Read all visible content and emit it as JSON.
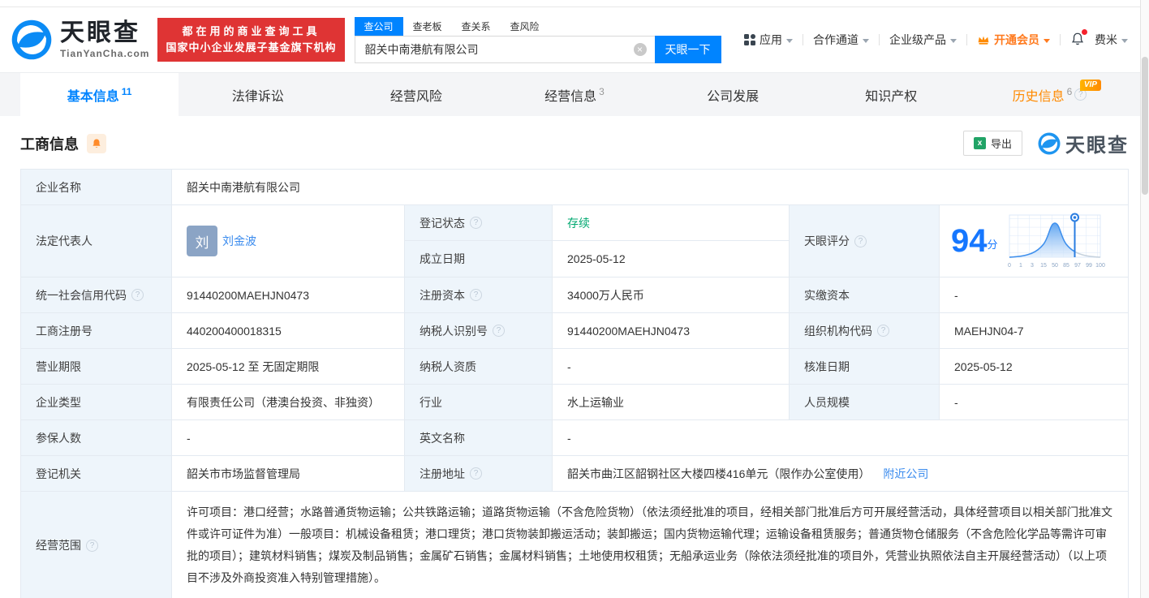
{
  "brand": {
    "name": "天眼查",
    "domain": "TianYanCha.com",
    "slogan_line1": "都在用的商业查询工具",
    "slogan_line2": "国家中小企业发展子基金旗下机构",
    "watermark": "天眼查"
  },
  "search": {
    "tabs": [
      "查公司",
      "查老板",
      "查关系",
      "查风险"
    ],
    "query": "韶关中南港航有限公司",
    "submit": "天眼一下"
  },
  "nav": {
    "apps": "应用",
    "channel": "合作通道",
    "products": "企业级产品",
    "vip": "开通会员",
    "user": "费米"
  },
  "page_tabs": {
    "t1": "基本信息",
    "t1_count": "11",
    "t2": "法律诉讼",
    "t3": "经营风险",
    "t4": "经营信息",
    "t4_count": "3",
    "t5": "公司发展",
    "t6": "知识产权",
    "t7": "历史信息",
    "t7_count": "6",
    "t7_badge": "VIP"
  },
  "section": {
    "title": "工商信息",
    "export_label": "导出"
  },
  "score": {
    "label": "天眼评分",
    "value": "94",
    "unit": "分",
    "axis": [
      "0",
      "1",
      "3",
      "15",
      "50",
      "85",
      "97",
      "99",
      "100"
    ]
  },
  "info": {
    "company_name_label": "企业名称",
    "company_name": "韶关中南港航有限公司",
    "legal_rep_label": "法定代表人",
    "legal_rep_avatar": "刘",
    "legal_rep_name": "刘金波",
    "reg_status_label": "登记状态",
    "reg_status": "存续",
    "establish_label": "成立日期",
    "establish": "2025-05-12",
    "credit_code_label": "统一社会信用代码",
    "credit_code": "91440200MAEHJN0473",
    "reg_capital_label": "注册资本",
    "reg_capital": "34000万人民币",
    "paid_capital_label": "实缴资本",
    "paid_capital": "-",
    "reg_number_label": "工商注册号",
    "reg_number": "440200400018315",
    "taxpayer_id_label": "纳税人识别号",
    "taxpayer_id": "91440200MAEHJN0473",
    "org_code_label": "组织机构代码",
    "org_code": "MAEHJN04-7",
    "business_term_label": "营业期限",
    "business_term": "2025-05-12 至 无固定期限",
    "taxpayer_quality_label": "纳税人资质",
    "taxpayer_quality": "-",
    "approval_date_label": "核准日期",
    "approval_date": "2025-05-12",
    "company_type_label": "企业类型",
    "company_type": "有限责任公司（港澳台投资、非独资）",
    "industry_label": "行业",
    "industry": "水上运输业",
    "staff_size_label": "人员规模",
    "staff_size": "-",
    "insured_label": "参保人数",
    "insured": "-",
    "english_name_label": "英文名称",
    "english_name": "-",
    "reg_authority_label": "登记机关",
    "reg_authority": "韶关市市场监督管理局",
    "address_label": "注册地址",
    "address": "韶关市曲江区韶钢社区大楼四楼416单元（限作办公室使用）",
    "address_link": "附近公司",
    "business_scope_label": "经营范围",
    "business_scope": "许可项目：港口经营；水路普通货物运输；公共铁路运输；道路货物运输（不含危险货物）（依法须经批准的项目，经相关部门批准后方可开展经营活动，具体经营项目以相关部门批准文件或许可证件为准）一般项目：机械设备租赁；港口理货；港口货物装卸搬运活动；装卸搬运；国内货物运输代理；运输设备租赁服务；普通货物仓储服务（不含危险化学品等需许可审批的项目）；建筑材料销售；煤炭及制品销售；金属矿石销售；金属材料销售；土地使用权租赁；无船承运业务（除依法须经批准的项目外，凭营业执照依法自主开展经营活动）（以上项目不涉及外商投资准入特别管理措施）。"
  }
}
